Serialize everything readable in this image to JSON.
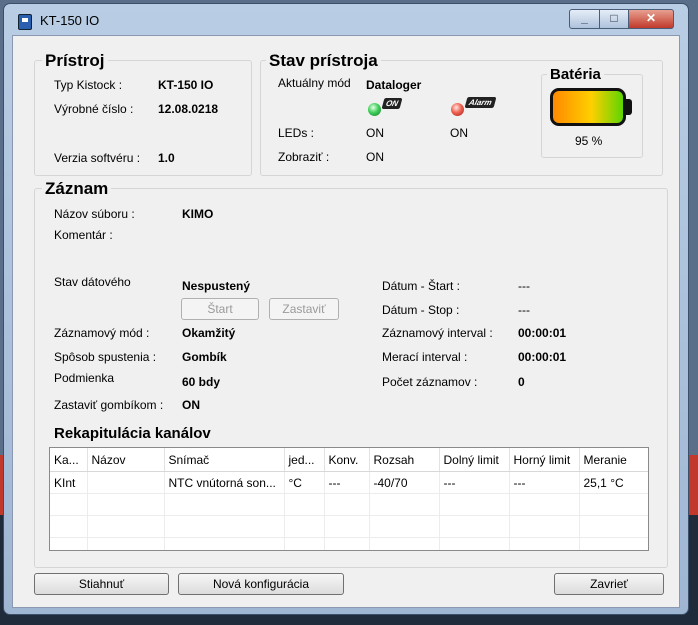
{
  "window": {
    "title": "KT-150 IO",
    "minimize": "_",
    "maximize": "□",
    "close": "✕"
  },
  "pristroj": {
    "title": "Prístroj",
    "typ_label": "Typ Kistock :",
    "typ_value": "KT-150 IO",
    "vyrobne_label": "Výrobné číslo :",
    "vyrobne_value": "12.08.0218",
    "verzia_label": "Verzia softvéru :",
    "verzia_value": "1.0"
  },
  "stav": {
    "title": "Stav prístroja",
    "mod_label": "Aktuálny mód",
    "mod_value": "Dataloger",
    "led_on_badge": "ON",
    "led_alarm_badge": "Alarm",
    "leds_label": "LEDs :",
    "leds_value_1": "ON",
    "leds_value_2": "ON",
    "zobrazit_label": "Zobraziť :",
    "zobrazit_value": "ON"
  },
  "bateria": {
    "title": "Batéria",
    "percent_text": "95 %",
    "level_percent": 95
  },
  "zaznam": {
    "title": "Záznam",
    "nazov_label": "Názov súboru :",
    "nazov_value": "KIMO",
    "komentar_label": "Komentár :",
    "stav_label": "Stav dátového",
    "stav_value": "Nespustený",
    "start_button": "Štart",
    "stop_button": "Zastaviť",
    "mod_label": "Záznamový mód :",
    "mod_value": "Okamžitý",
    "sposob_label": "Spôsob spustenia :",
    "sposob_value": "Gombík",
    "podmienka_label": "Podmienka",
    "podmienka_value": "60 bdy",
    "zastavit_label": "Zastaviť gombíkom :",
    "zastavit_value": "ON",
    "datum_start_label": "Dátum - Štart :",
    "datum_start_value": "---",
    "datum_stop_label": "Dátum - Stop :",
    "datum_stop_value": "---",
    "zaz_interval_label": "Záznamový interval :",
    "zaz_interval_value": "00:00:01",
    "mer_interval_label": "Merací interval :",
    "mer_interval_value": "00:00:01",
    "pocet_label": "Počet záznamov :",
    "pocet_value": "0"
  },
  "rekapitulacia": {
    "title": "Rekapitulácia kanálov",
    "columns": [
      "Ka...",
      "Názov",
      "Snímač",
      "jed...",
      "Konv.",
      "Rozsah",
      "Dolný limit",
      "Horný limit",
      "Meranie"
    ],
    "rows": [
      [
        "KInt",
        "",
        "NTC vnútorná son...",
        "°C",
        "---",
        "-40/70",
        "---",
        "---",
        "25,1 °C"
      ]
    ]
  },
  "footer": {
    "stiahnut": "Stiahnuť",
    "nova": "Nová konfigurácia",
    "zavriet": "Zavrieť"
  }
}
